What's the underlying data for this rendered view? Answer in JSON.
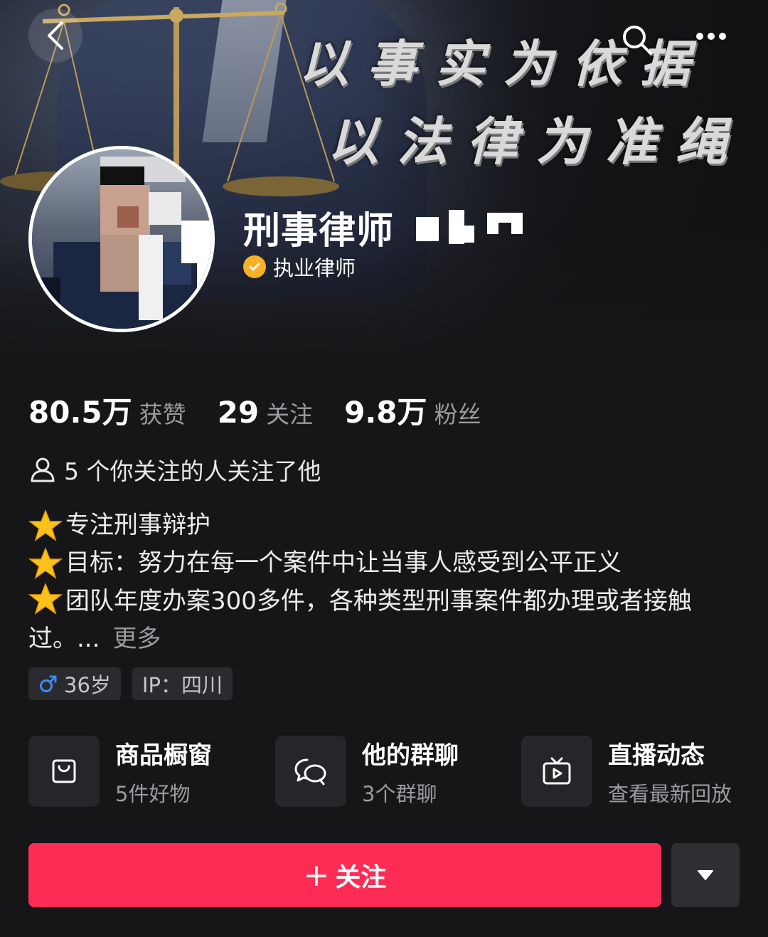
{
  "banner": {
    "slogan_line1": "以事实为依据",
    "slogan_line2": "以法律为准绳"
  },
  "profile": {
    "name": "刑事律师",
    "verification": "执业律师"
  },
  "stats": [
    {
      "value": "80.5万",
      "label": "获赞"
    },
    {
      "value": "29",
      "label": "关注"
    },
    {
      "value": "9.8万",
      "label": "粉丝"
    }
  ],
  "mutual": "5 个你关注的人关注了他",
  "bio": {
    "line1": "专注刑事辩护",
    "line2": "目标：努力在每一个案件中让当事人感受到公平正义",
    "line3": "团队年度办案300多件，各种类型刑事案件都办理或者接触过。...",
    "more": "更多"
  },
  "tags": {
    "age": "36岁",
    "ip": "IP：四川"
  },
  "features": [
    {
      "title": "商品橱窗",
      "sub": "5件好物",
      "icon": "shopping-bag-icon"
    },
    {
      "title": "他的群聊",
      "sub": "3个群聊",
      "icon": "chat-bubbles-icon"
    },
    {
      "title": "直播动态",
      "sub": "查看最新回放",
      "icon": "tv-icon"
    }
  ],
  "actions": {
    "follow": "关注",
    "follow_icon": "+"
  },
  "colors": {
    "accent": "#fd2c55",
    "verify": "#f5b12a",
    "background": "#161618"
  }
}
